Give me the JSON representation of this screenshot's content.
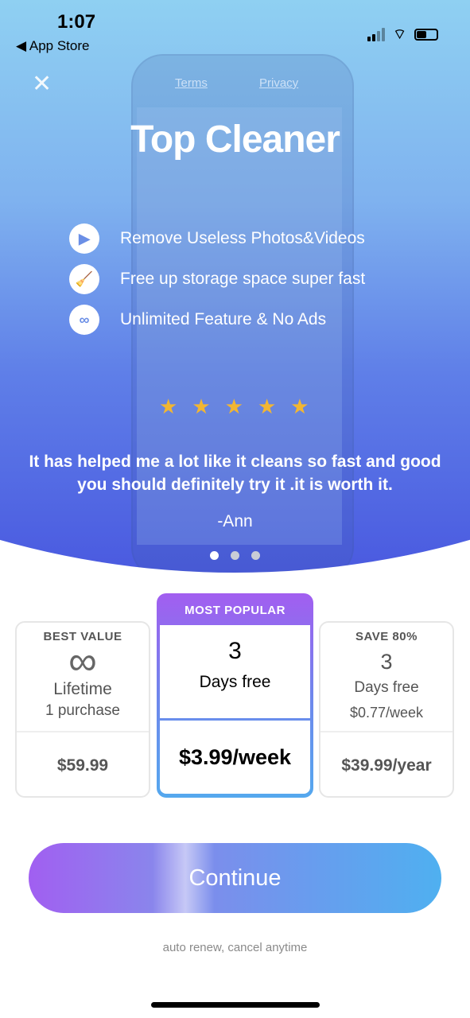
{
  "status": {
    "time": "1:07",
    "back": "◀ App Store"
  },
  "header": {
    "close": "✕",
    "terms": "Terms",
    "privacy": "Privacy"
  },
  "title": "Top Cleaner",
  "features": [
    {
      "icon": "video-icon",
      "glyph": "▶",
      "text": "Remove Useless Photos&Videos"
    },
    {
      "icon": "broom-icon",
      "glyph": "🧹",
      "text": "Free up storage space super fast"
    },
    {
      "icon": "infinity-icon",
      "glyph": "∞",
      "text": "Unlimited Feature & No Ads"
    }
  ],
  "rating": {
    "stars": 5,
    "glyph": "★"
  },
  "review": {
    "text": "It has helped me a lot like it cleans so fast and good you should definitely try it .it is worth it.",
    "author": "-Ann"
  },
  "carousel": {
    "pages": 3,
    "active": 0
  },
  "plans": [
    {
      "badge": "BEST VALUE",
      "icon": "∞",
      "line1": "Lifetime",
      "line2": "1 purchase",
      "price": "$59.99"
    },
    {
      "badge": "MOST POPULAR",
      "big": "3",
      "line1": "Days free",
      "price": "$3.99/week",
      "selected": true
    },
    {
      "badge": "SAVE 80%",
      "big": "3",
      "line1": "Days free",
      "line2": "$0.77/week",
      "price": "$39.99/year"
    }
  ],
  "cta": "Continue",
  "footer": "auto renew, cancel anytime",
  "colors": {
    "star": "#f2b632",
    "accent_start": "#a15ff1",
    "accent_end": "#4fb0f0"
  }
}
